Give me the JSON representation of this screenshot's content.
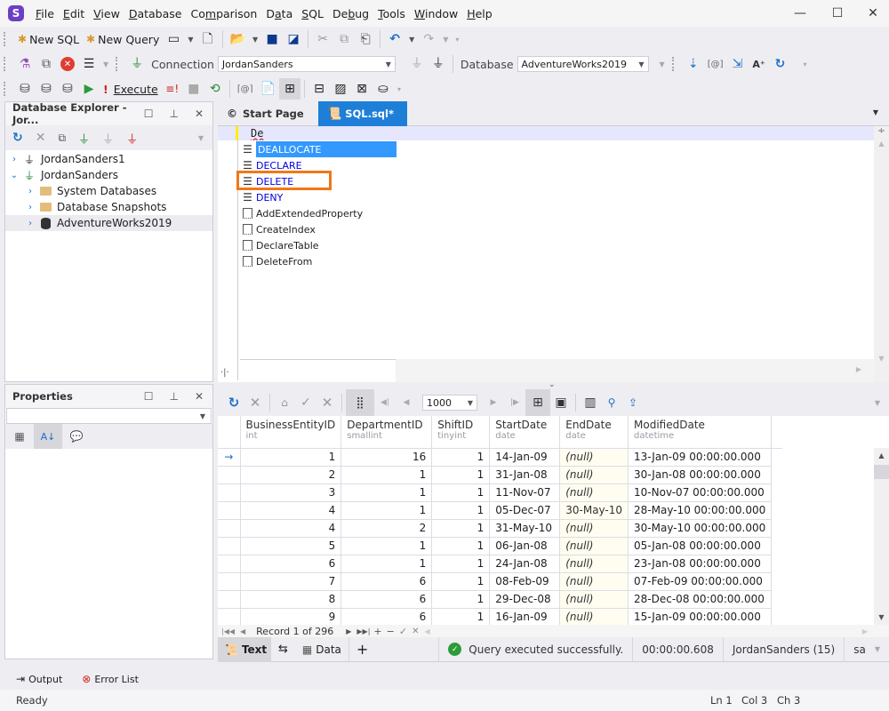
{
  "app": {
    "logo_letter": "S",
    "menu": [
      {
        "label": "File",
        "u": "F",
        "rest": "ile"
      },
      {
        "label": "Edit",
        "u": "E",
        "rest": "dit"
      },
      {
        "label": "View",
        "u": "V",
        "rest": "iew"
      },
      {
        "label": "Database",
        "u": "D",
        "rest": "atabase"
      },
      {
        "label": "Comparison",
        "pre": "Co",
        "u": "m",
        "rest": "parison"
      },
      {
        "label": "Data",
        "pre": "D",
        "u": "a",
        "rest": "ta"
      },
      {
        "label": "SQL",
        "u": "S",
        "rest": "QL"
      },
      {
        "label": "Debug",
        "pre": "De",
        "u": "b",
        "rest": "ug"
      },
      {
        "label": "Tools",
        "u": "T",
        "rest": "ools"
      },
      {
        "label": "Window",
        "u": "W",
        "rest": "indow"
      },
      {
        "label": "Help",
        "u": "H",
        "rest": "elp"
      }
    ],
    "window_controls": {
      "minimize": "—",
      "maximize": "☐",
      "close": "✕"
    }
  },
  "toolbar1": {
    "new_sql": "New SQL",
    "new_query": "New Query"
  },
  "toolbar2": {
    "connection_label": "Connection",
    "connection_value": "JordanSanders",
    "database_label": "Database",
    "database_value": "AdventureWorks2019"
  },
  "toolbar3": {
    "execute_label": "Execute",
    "execute_prefix": "!"
  },
  "database_explorer": {
    "title": "Database Explorer - Jor...",
    "tree": [
      {
        "label": "JordanSanders1",
        "level": 0,
        "expanded": false,
        "icon": "connection-icon"
      },
      {
        "label": "JordanSanders",
        "level": 0,
        "expanded": true,
        "icon": "connection-active-icon"
      },
      {
        "label": "System Databases",
        "level": 1,
        "expanded": false,
        "icon": "folder-icon"
      },
      {
        "label": "Database Snapshots",
        "level": 1,
        "expanded": false,
        "icon": "folder-icon"
      },
      {
        "label": "AdventureWorks2019",
        "level": 1,
        "expanded": false,
        "icon": "database-icon",
        "selected": true
      }
    ]
  },
  "properties": {
    "title": "Properties",
    "selector_value": ""
  },
  "tabs": [
    {
      "label": "Start Page",
      "active": false
    },
    {
      "label": "SQL.sql*",
      "active": true
    }
  ],
  "editor": {
    "line_text": "De",
    "autocomplete": [
      {
        "label": "DEALLOCATE",
        "kind": "keyword",
        "selected": true
      },
      {
        "label": "DECLARE",
        "kind": "keyword"
      },
      {
        "label": "DELETE",
        "kind": "keyword",
        "highlighted": true
      },
      {
        "label": "DENY",
        "kind": "keyword"
      },
      {
        "label": "AddExtendedProperty",
        "kind": "snippet"
      },
      {
        "label": "CreateIndex",
        "kind": "snippet"
      },
      {
        "label": "DeclareTable",
        "kind": "snippet"
      },
      {
        "label": "DeleteFrom",
        "kind": "snippet"
      }
    ],
    "highlight_color": "#f07818"
  },
  "grid_toolbar": {
    "page_size": "1000"
  },
  "grid": {
    "columns": [
      {
        "name": "BusinessEntityID",
        "type": "int"
      },
      {
        "name": "DepartmentID",
        "type": "smallint"
      },
      {
        "name": "ShiftID",
        "type": "tinyint"
      },
      {
        "name": "StartDate",
        "type": "date"
      },
      {
        "name": "EndDate",
        "type": "date"
      },
      {
        "name": "ModifiedDate",
        "type": "datetime"
      }
    ],
    "rows": [
      [
        "1",
        "16",
        "1",
        "14-Jan-09",
        "(null)",
        "13-Jan-09 00:00:00.000"
      ],
      [
        "2",
        "1",
        "1",
        "31-Jan-08",
        "(null)",
        "30-Jan-08 00:00:00.000"
      ],
      [
        "3",
        "1",
        "1",
        "11-Nov-07",
        "(null)",
        "10-Nov-07 00:00:00.000"
      ],
      [
        "4",
        "1",
        "1",
        "05-Dec-07",
        "30-May-10",
        "28-May-10 00:00:00.000"
      ],
      [
        "4",
        "2",
        "1",
        "31-May-10",
        "(null)",
        "30-May-10 00:00:00.000"
      ],
      [
        "5",
        "1",
        "1",
        "06-Jan-08",
        "(null)",
        "05-Jan-08 00:00:00.000"
      ],
      [
        "6",
        "1",
        "1",
        "24-Jan-08",
        "(null)",
        "23-Jan-08 00:00:00.000"
      ],
      [
        "7",
        "6",
        "1",
        "08-Feb-09",
        "(null)",
        "07-Feb-09 00:00:00.000"
      ],
      [
        "8",
        "6",
        "1",
        "29-Dec-08",
        "(null)",
        "28-Dec-08 00:00:00.000"
      ],
      [
        "9",
        "6",
        "1",
        "16-Jan-09",
        "(null)",
        "15-Jan-09 00:00:00.000"
      ]
    ],
    "record_nav": "Record 1 of 296"
  },
  "result_tabs": {
    "text": "Text",
    "data": "Data",
    "add": "+"
  },
  "result_status": {
    "message": "Query executed successfully.",
    "elapsed": "00:00:00.608",
    "connection": "JordanSanders (15)",
    "user": "sa"
  },
  "bottom_tabs": {
    "output": "Output",
    "error_list": "Error List"
  },
  "statusbar": {
    "ready": "Ready",
    "ln": "Ln 1",
    "col": "Col 3",
    "ch": "Ch 3"
  }
}
